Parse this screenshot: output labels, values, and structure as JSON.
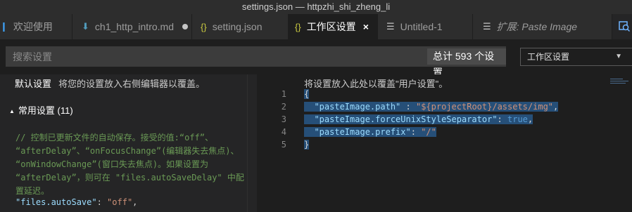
{
  "window": {
    "title": "settings.json — httpzhi_shi_zheng_li"
  },
  "tabs": [
    {
      "label": "欢迎使用",
      "icon": "vscode-logo-icon",
      "italic": false
    },
    {
      "label": "ch1_http_intro.md",
      "icon": "markdown-icon",
      "dirty": true
    },
    {
      "label": "setting.json",
      "icon": "json-braces-icon"
    },
    {
      "label": "工作区设置",
      "icon": "json-braces-icon",
      "active": true,
      "close": "×"
    },
    {
      "label": "Untitled-1",
      "icon": "lines-icon"
    },
    {
      "label": "扩展: Paste Image",
      "icon": "extension-doc-icon",
      "italic": true
    }
  ],
  "search": {
    "placeholder": "搜索设置",
    "count": "总计 593 个设置"
  },
  "scope": {
    "selected": "工作区设置"
  },
  "default_settings": {
    "title": "默认设置",
    "hint": "将您的设置放入右侧编辑器以覆盖。",
    "group": "常用设置 (11)",
    "comment_lines": [
      "// 控制已更新文件的自动保存。接受的值:“off”、",
      "“afterDelay”、“onFocusChange”(编辑器失去焦点)、",
      "“onWindowChange”(窗口失去焦点)。如果设置为",
      "“afterDelay”，则可在 \"files.autoSaveDelay\" 中配",
      "置延迟。"
    ],
    "setting_key": "\"files.autoSave\"",
    "setting_value": "\"off\""
  },
  "workspace_editor": {
    "hint": "将设置放入此处以覆盖\"用户设置\"。",
    "line_numbers": [
      "1",
      "2",
      "3",
      "4",
      "5"
    ],
    "open_brace": "{",
    "close_brace": "}",
    "entries": [
      {
        "key": "\"pasteImage.path\"",
        "sep": " : ",
        "value": "\"${projectRoot}/assets/img\"",
        "type": "string",
        "trail": ","
      },
      {
        "key": "\"pasteImage.forceUnixStyleSeparator\"",
        "sep": ": ",
        "value": "true",
        "type": "bool",
        "trail": ","
      },
      {
        "key": "\"pasteImage.prefix\"",
        "sep": ": ",
        "value": "\"/\"",
        "type": "string",
        "trail": ""
      }
    ]
  },
  "colors": {
    "accent": "#0e639c",
    "selection": "#264f78",
    "comment": "#6a9955",
    "string": "#ce9178",
    "key": "#9cdcfe",
    "keyword": "#569cd6"
  }
}
